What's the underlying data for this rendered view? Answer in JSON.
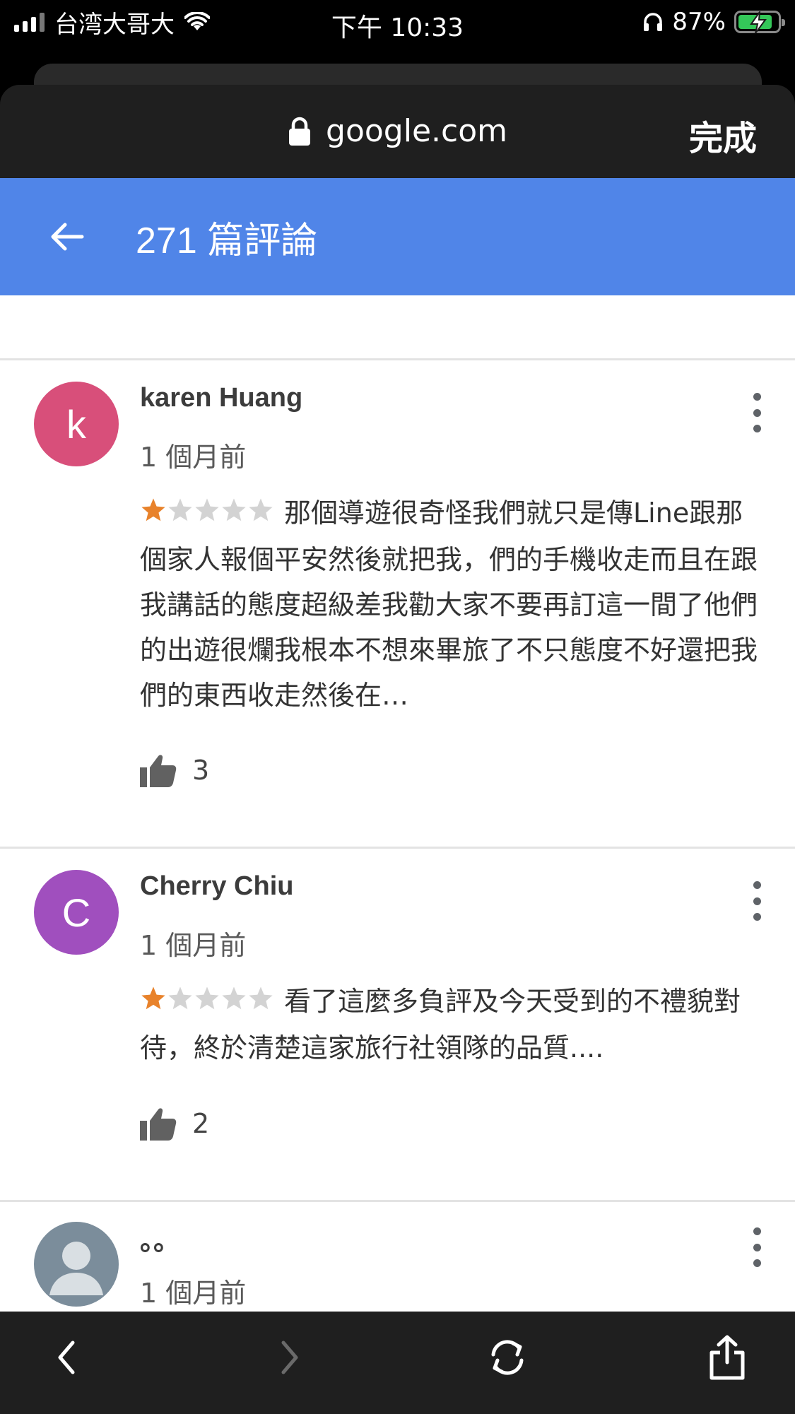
{
  "status_bar": {
    "carrier": "台湾大哥大",
    "time": "下午 10:33",
    "battery": "87%",
    "battery_level": 0.87,
    "icons": [
      "signal-icon",
      "wifi-icon",
      "headphones-icon",
      "battery-charging-icon"
    ]
  },
  "browser": {
    "domain": "google.com",
    "done_label": "完成"
  },
  "header": {
    "title": "271 篇評論"
  },
  "reviews": [
    {
      "name": "karen Huang",
      "avatar_letter": "k",
      "avatar_color": "#d84f7a",
      "date": "1 個月前",
      "rating": 1,
      "text": "那個導遊很奇怪我們就只是傳Line跟那個家人報個平安然後就把我，們的手機收走而且在跟我講話的態度超級差我勸大家不要再訂這一間了他們的出遊很爛我根本不想來畢旅了不只態度不好還把我們的東西收走然後在…",
      "likes": "3"
    },
    {
      "name": "Cherry Chiu",
      "avatar_letter": "C",
      "avatar_color": "#a04fbe",
      "date": "1 個月前",
      "rating": 1,
      "text": "看了這麼多負評及今天受到的不禮貌對待，終於清楚這家旅行社領隊的品質....",
      "likes": "2"
    },
    {
      "name": "。。",
      "avatar_letter": "",
      "avatar_color": "#7b8d9b",
      "date": "1 個月前"
    }
  ],
  "colors": {
    "header_blue": "#5085e8",
    "star_filled": "#e8822b",
    "star_empty": "#d3d3d3"
  },
  "toolbar": {
    "icons": [
      "back-icon",
      "forward-icon",
      "reload-icon",
      "share-icon"
    ]
  }
}
